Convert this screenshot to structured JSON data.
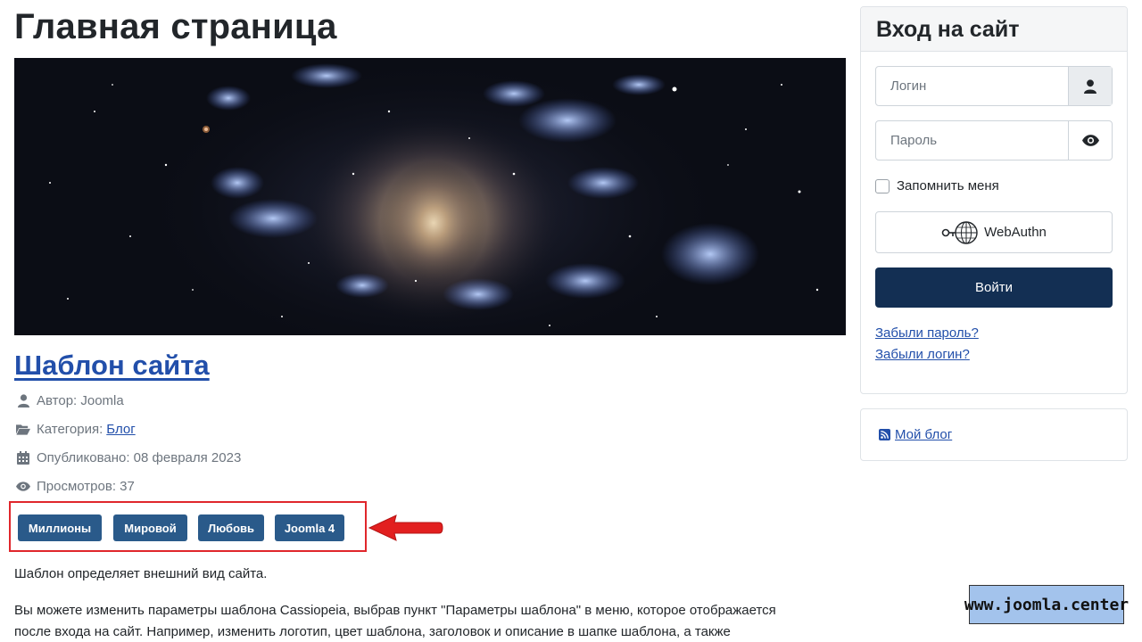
{
  "page": {
    "title": "Главная страница"
  },
  "article": {
    "title": "Шаблон сайта",
    "meta": {
      "author_label": "Автор: Joomla",
      "category_label": "Категория:",
      "category_link": "Блог",
      "published_label": "Опубликовано: 08 февраля 2023",
      "views_label": "Просмотров: 37"
    },
    "tags": [
      "Миллионы",
      "Мировой",
      "Любовь",
      "Joomla 4"
    ],
    "paragraphs": [
      "Шаблон определяет внешний вид сайта.",
      "Вы можете изменить параметры шаблона Cassiopeia, выбрав пункт \"Параметры шаблона\" в меню, которое отображается",
      "после входа на сайт. Например, изменить логотип, цвет шаблона, заголовок и описание в шапке шаблона, а также"
    ]
  },
  "login": {
    "title": "Вход на сайт",
    "username_placeholder": "Логин",
    "password_placeholder": "Пароль",
    "remember_label": "Запомнить меня",
    "webauthn_label": "WebAuthn",
    "submit_label": "Войти",
    "forgot_password": "Забыли пароль?",
    "forgot_login": "Забыли логин?"
  },
  "blog_module": {
    "link": "Мой блог"
  },
  "watermark": {
    "text": "www.joomla.center"
  },
  "colors": {
    "link": "#224faa",
    "tag_bg": "#2a5a8a",
    "button_bg": "#132f53",
    "highlight_border": "#e0262b",
    "watermark_bg": "#a3c3ec"
  },
  "icons": {
    "author": "user-icon",
    "category": "folder-open-icon",
    "published": "calendar-icon",
    "views": "eye-icon",
    "username": "user-icon",
    "password": "eye-icon",
    "webauthn": "key-globe-icon",
    "blog": "rss-icon"
  }
}
